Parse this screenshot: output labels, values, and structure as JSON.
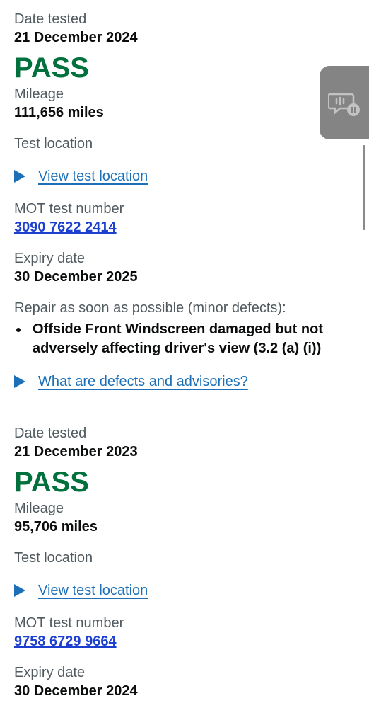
{
  "records": [
    {
      "date_label": "Date tested",
      "date": "21 December 2024",
      "result": "PASS",
      "mileage_label": "Mileage",
      "mileage": "111,656 miles",
      "location_label": "Test location",
      "location_link": "View test location",
      "mot_label": "MOT test number",
      "mot_number": "3090 7622 2414",
      "expiry_label": "Expiry date",
      "expiry": "30 December 2025",
      "defects_heading": "Repair as soon as possible (minor defects):",
      "defects": [
        "Offside Front Windscreen damaged but not adversely affecting driver's view (3.2 (a) (i))"
      ],
      "defects_link": "What are defects and advisories?"
    },
    {
      "date_label": "Date tested",
      "date": "21 December 2023",
      "result": "PASS",
      "mileage_label": "Mileage",
      "mileage": "95,706 miles",
      "location_label": "Test location",
      "location_link": "View test location",
      "mot_label": "MOT test number",
      "mot_number": "9758 6729 9664",
      "expiry_label": "Expiry date",
      "expiry": "30 December 2024"
    }
  ],
  "overlay": {
    "icon": "voice-chat-pause-icon",
    "color": "#7a7a7a"
  },
  "colors": {
    "pass": "#00703c",
    "link": "#1d70b8",
    "test_number_link": "#1d3fcf"
  }
}
